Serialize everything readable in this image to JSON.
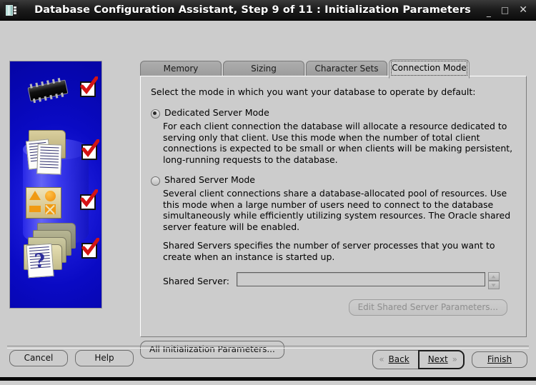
{
  "window": {
    "title": "Database Configuration Assistant, Step 9 of 11 : Initialization Parameters",
    "icon": "app-icon",
    "controls": {
      "minimize": "_",
      "maximize": "□",
      "close": "✕"
    }
  },
  "tabs": [
    {
      "label": "Memory",
      "active": false
    },
    {
      "label": "Sizing",
      "active": false
    },
    {
      "label": "Character Sets",
      "active": false
    },
    {
      "label": "Connection Mode",
      "active": true
    }
  ],
  "panel": {
    "intro": "Select the mode in which you want your database to operate by default:",
    "options": [
      {
        "label": "Dedicated Server Mode",
        "selected": true,
        "description": "For each client connection the database will allocate a resource dedicated to serving only that client.  Use this mode when the number of total client connections is expected to be small or when clients will be making persistent, long-running requests to the database."
      },
      {
        "label": "Shared Server Mode",
        "selected": false,
        "description": "Several client connections share a database-allocated pool of resources.  Use this mode when a large number of users need to connect to the database simultaneously while efficiently utilizing system resources.  The Oracle shared server feature will be enabled."
      }
    ],
    "note": "Shared Servers specifies the number of server processes that you want to create when an instance is started up.",
    "shared_server": {
      "label": "Shared Server:",
      "value": "",
      "placeholder": "",
      "spinner_up": "up-arrow-icon",
      "spinner_down": "down-arrow-icon",
      "enabled": false
    },
    "edit_params_button": {
      "label": "Edit Shared Server Parameters...",
      "enabled": false
    }
  },
  "all_params_button": {
    "label": "All Initialization Parameters..."
  },
  "footer": {
    "cancel": "Cancel",
    "help": "Help",
    "back": "Back",
    "next": "Next",
    "finish": "Finish",
    "back_arrow": "«",
    "next_arrow": "»"
  },
  "sidebar_graphic": {
    "name": "oracle-database-illustration",
    "items": [
      "chip-icon",
      "folder-documents-icon",
      "shapes-panel-icon",
      "folder-stack-question-icon"
    ],
    "check_marks": 4,
    "background_color": "#0b0bcf",
    "check_color": "#d41414"
  }
}
